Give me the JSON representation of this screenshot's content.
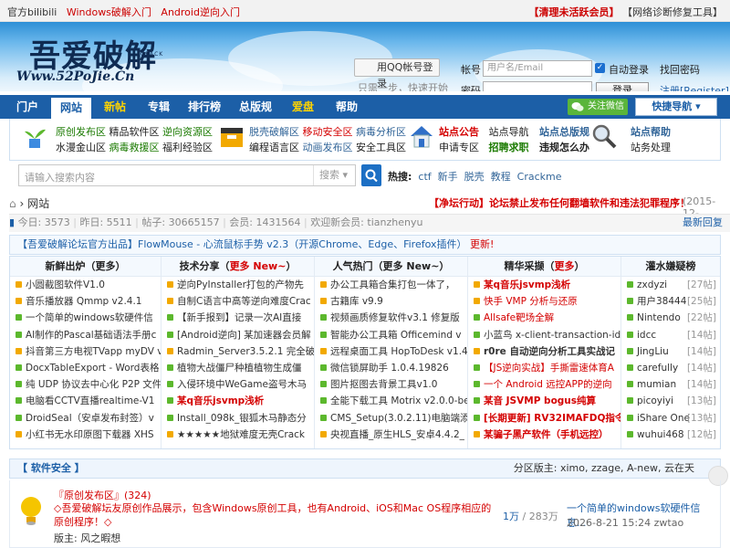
{
  "topbar": {
    "left": [
      "官方bilibili",
      "Windows破解入门",
      "Android逆向入门"
    ],
    "right": [
      "【清理未活跃会员】",
      "【网络诊断修复工具】"
    ]
  },
  "logo": {
    "main": "吾爱破解",
    "url": "Www.52PoJie.Cn",
    "sub": "CRACK"
  },
  "login": {
    "qq_button": "用QQ帐号登录",
    "qq_tip": "只需一步，快速开始",
    "account_label": "帐号",
    "account_placeholder": "用户名/Email",
    "password_label": "密码",
    "remember": "自动登录",
    "find_password": "找回密码",
    "register": "注册[Register]",
    "login_button": "登录"
  },
  "nav": {
    "items": [
      "门户",
      "网站",
      "新帖",
      "专辑",
      "排行榜",
      "总版规",
      "爱盘",
      "帮助"
    ],
    "wechat": "关注微信",
    "quick": "快捷导航 ▾"
  },
  "links": {
    "c1": [
      [
        "原创发布区",
        "精品软件区",
        "逆向资源区"
      ],
      [
        "水漫金山区",
        "病毒救援区",
        "福利经验区"
      ]
    ],
    "c2": [
      [
        "脱壳破解区",
        "移动安全区",
        "病毒分析区"
      ],
      [
        "编程语言区",
        "动画发布区",
        "安全工具区"
      ]
    ],
    "c3": [
      [
        "站点公告",
        "站点导航"
      ],
      [
        "申请专区",
        "招聘求职"
      ]
    ],
    "c4": [
      [
        "站点总版规"
      ],
      [
        "违规怎么办"
      ]
    ],
    "c5": [
      [
        "站点帮助"
      ],
      [
        "站务处理"
      ]
    ]
  },
  "search": {
    "placeholder": "请输入搜索内容",
    "select": "搜索 ▾",
    "hot_label": "热搜:",
    "hot": [
      "ctf",
      "新手",
      "脱壳",
      "教程",
      "Crackme"
    ]
  },
  "crumb": {
    "home": "网站"
  },
  "notice": "【净坛行动】论坛禁止发布任何翻墙软件和违法犯罪程序！",
  "notice_date": "(2015-12-",
  "stats": {
    "today": "今日: 3573",
    "yesterday": "昨日: 5511",
    "posts": "帖子: 30665157",
    "members": "会员: 1431564",
    "newest": "欢迎新会员: tianzhenyu",
    "latest_reply": "最新回复"
  },
  "promo": {
    "tag": "【吾爱破解论坛官方出品】",
    "text": "FlowMouse - 心流鼠标手势 v2.3（开源Chrome、Edge、Firefox插件）",
    "update": " 更新!"
  },
  "board": {
    "headers": [
      "新鲜出炉（更多）",
      "技术分享（更多 New~）",
      "人气热门（更多 New~）",
      "精华采撷（更多）",
      "灌水嫌疑榜"
    ],
    "col1": [
      "小圆截图软件V1.0",
      "音乐播放器 Qmmp v2.4.1",
      "一个简单的windows软硬件信",
      "AI制作的Pascal基础语法手册c",
      "抖音第三方电视TVapp myDV v",
      "DocxTableExport - Word表格",
      "纯 UDP 协议去中心化 P2P 文件",
      "电脑看CCTV直播realtime-V1",
      "DroidSeal（安卓发布封签）v",
      "小红书无水印原图下载器 XHS"
    ],
    "col2": [
      "逆向PyInstaller打包的产物先",
      "自制C语言中高等逆向难度Crac",
      "【新手报到】记录一次AI直接",
      "[Android逆向] 某加速器会员解",
      "Radmin_Server3.5.2.1 完全破",
      "植物大战僵尸种植植物生成僵",
      "入侵环境中WeGame盗号木马",
      "某q音乐jsvmp浅析",
      "Install_098k_银狐木马静态分",
      "★★★★★地狱难度无壳Crack"
    ],
    "col3": [
      "办公工具箱合集打包一体了，",
      "古籍库 v9.9",
      "视频画质修复软件v3.1 修复版",
      "智能办公工具箱 Officemind v",
      "远程桌面工具 HopToDesk v1.4",
      "微信锁屏助手 1.0.4.19826",
      "图片抠图去背景工具v1.0",
      "全能下载工具 Motrix v2.0.0-be",
      "CMS_Setup(3.0.2.11)电脑端添",
      "央视直播_原生HLS_安卓4.4.2_"
    ],
    "col4": [
      "某q音乐jsvmp浅析",
      "快手 VMP 分析与还原",
      "Allsafe靶场全解",
      "小蓝鸟 x-client-transaction-id",
      "r0re 自动逆向分析工具实战记",
      "【JS逆向实战】手撕雷速体育A",
      "一个 Android 远控APP的逆向",
      "某音 JSVMP bogus纯算",
      "[长期更新] RV32IMAFDQ指令",
      "某骗子黑产软件（手机远控）"
    ],
    "col5": [
      [
        "zxdyzi",
        "[27帖]"
      ],
      [
        "用户38444",
        "[25帖]"
      ],
      [
        "Nintendo",
        "[22帖]"
      ],
      [
        "idcc",
        "[14帖]"
      ],
      [
        "JingLiu",
        "[14帖]"
      ],
      [
        "carefully",
        "[14帖]"
      ],
      [
        "mumian",
        "[14帖]"
      ],
      [
        "picoyiyi",
        "[13帖]"
      ],
      [
        "iShare One",
        "[13帖]"
      ],
      [
        "wuhui468",
        "[12帖]"
      ]
    ]
  },
  "section": {
    "title": "【 软件安全 】",
    "mods": "分区版主: ximo, zzage, A-new, 云在天"
  },
  "forum": {
    "name": "『原创发布区』",
    "count": "(324)",
    "desc": "◇吾爱破解坛友原创作品展示，包含Windows原创工具，也有Android、iOS和Mac OS程序相应的原创程序！◇",
    "moderator": "版主: 风之暇想",
    "threads": "1万",
    "posts": "/ 283万",
    "last_title": "一个简单的windows软硬件信息...",
    "last_time": "2026-8-21 15:24 zwtao"
  }
}
